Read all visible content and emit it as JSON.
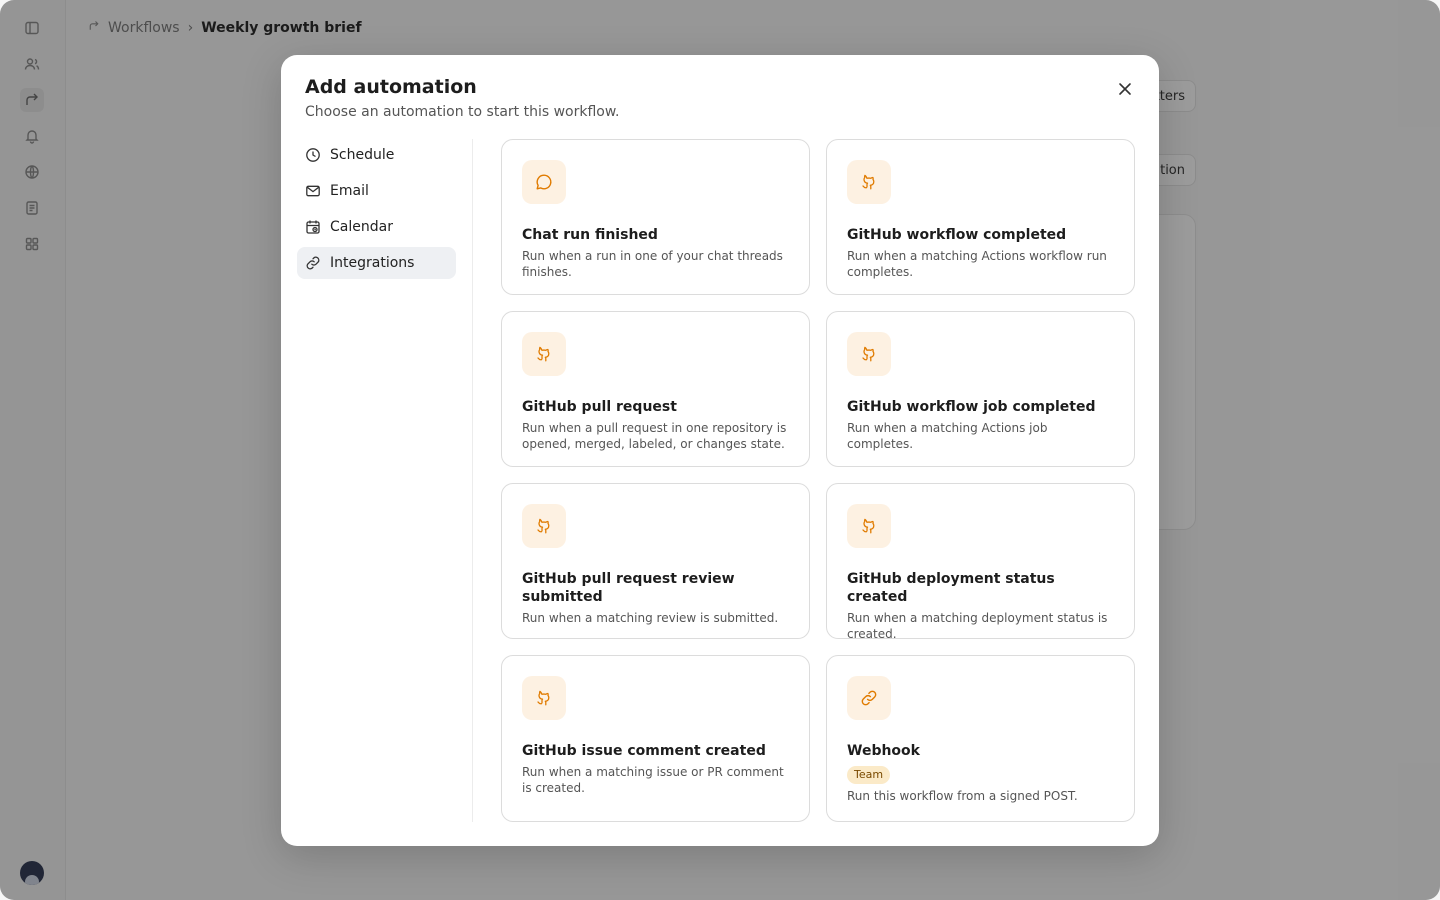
{
  "breadcrumb": {
    "parent": "Workflows",
    "separator": "›",
    "current": "Weekly growth brief"
  },
  "background": {
    "button_top": "tters",
    "button_mid": "ation"
  },
  "modal": {
    "title": "Add automation",
    "subtitle": "Choose an automation to start this workflow.",
    "close_icon": "close-icon"
  },
  "nav": {
    "items": [
      {
        "label": "Schedule",
        "icon": "clock-icon",
        "active": false
      },
      {
        "label": "Email",
        "icon": "mail-icon",
        "active": false
      },
      {
        "label": "Calendar",
        "icon": "calendar-icon",
        "active": false
      },
      {
        "label": "Integrations",
        "icon": "link-icon",
        "active": true
      }
    ]
  },
  "cards": [
    {
      "title": "Chat run finished",
      "desc": "Run when a run in one of your chat threads finishes.",
      "icon": "chat-bubble-icon"
    },
    {
      "title": "GitHub workflow completed",
      "desc": "Run when a matching Actions workflow run completes.",
      "icon": "github-icon"
    },
    {
      "title": "GitHub pull request",
      "desc": "Run when a pull request in one repository is opened, merged, labeled, or changes state.",
      "icon": "github-icon"
    },
    {
      "title": "GitHub workflow job completed",
      "desc": "Run when a matching Actions job completes.",
      "icon": "github-icon"
    },
    {
      "title": "GitHub pull request review submitted",
      "desc": "Run when a matching review is submitted.",
      "icon": "github-icon"
    },
    {
      "title": "GitHub deployment status created",
      "desc": "Run when a matching deployment status is created.",
      "icon": "github-icon"
    },
    {
      "title": "GitHub issue comment created",
      "desc": "Run when a matching issue or PR comment is created.",
      "icon": "github-icon"
    },
    {
      "title": "Webhook",
      "badge": "Team",
      "desc": "Run this workflow from a signed POST.",
      "icon": "link-icon"
    }
  ],
  "colors": {
    "accent": "#e07b00",
    "icon_bg": "#fdf1e2",
    "badge_bg": "#fbeac8",
    "active_nav": "#eef0f3"
  }
}
